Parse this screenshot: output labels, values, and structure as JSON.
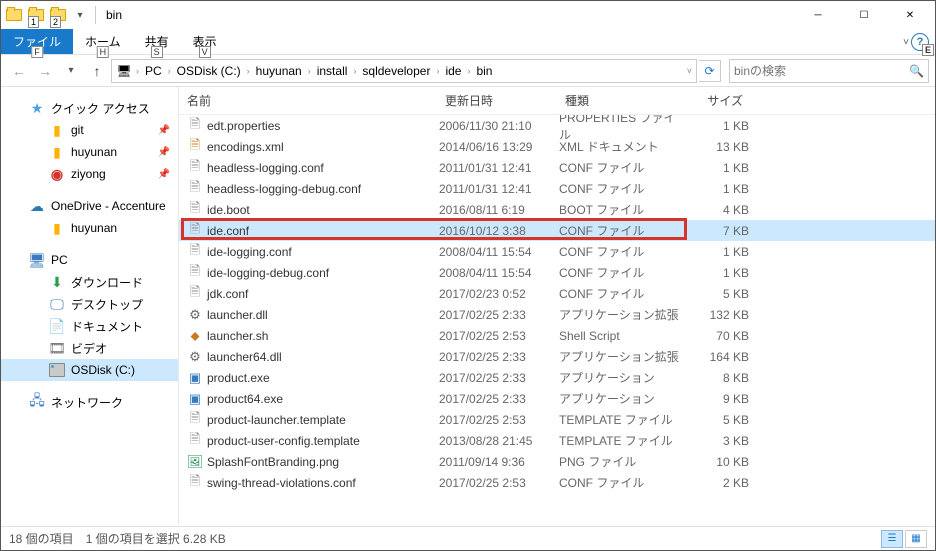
{
  "window": {
    "title": "bin"
  },
  "qat_badges": [
    "1",
    "2"
  ],
  "tabs": {
    "file": "ファイル",
    "file_kbd": "F",
    "home": "ホーム",
    "home_kbd": "H",
    "share": "共有",
    "share_kbd": "S",
    "view": "表示",
    "view_kbd": "V",
    "help_kbd": "E"
  },
  "breadcrumb": [
    "PC",
    "OSDisk (C:)",
    "huyunan",
    "install",
    "sqldeveloper",
    "ide",
    "bin"
  ],
  "search": {
    "placeholder": "binの検索"
  },
  "navpane": {
    "quick": "クイック アクセス",
    "items": [
      "git",
      "huyunan",
      "ziyong"
    ],
    "onedrive": "OneDrive - Accenture",
    "od_items": [
      "huyunan"
    ],
    "pc": "PC",
    "pc_items": [
      "ダウンロード",
      "デスクトップ",
      "ドキュメント",
      "ビデオ",
      "OSDisk (C:)"
    ],
    "network": "ネットワーク"
  },
  "columns": {
    "name": "名前",
    "date": "更新日時",
    "type": "種類",
    "size": "サイズ"
  },
  "files": [
    {
      "name": "edt.properties",
      "date": "2006/11/30 21:10",
      "type": "PROPERTIES ファイル",
      "size": "1 KB",
      "icon": "doc"
    },
    {
      "name": "encodings.xml",
      "date": "2014/06/16 13:29",
      "type": "XML ドキュメント",
      "size": "13 KB",
      "icon": "xml"
    },
    {
      "name": "headless-logging.conf",
      "date": "2011/01/31 12:41",
      "type": "CONF ファイル",
      "size": "1 KB",
      "icon": "doc"
    },
    {
      "name": "headless-logging-debug.conf",
      "date": "2011/01/31 12:41",
      "type": "CONF ファイル",
      "size": "1 KB",
      "icon": "doc"
    },
    {
      "name": "ide.boot",
      "date": "2016/08/11 6:19",
      "type": "BOOT ファイル",
      "size": "4 KB",
      "icon": "doc"
    },
    {
      "name": "ide.conf",
      "date": "2016/10/12 3:38",
      "type": "CONF ファイル",
      "size": "7 KB",
      "icon": "doc",
      "selected": true
    },
    {
      "name": "ide-logging.conf",
      "date": "2008/04/11 15:54",
      "type": "CONF ファイル",
      "size": "1 KB",
      "icon": "doc"
    },
    {
      "name": "ide-logging-debug.conf",
      "date": "2008/04/11 15:54",
      "type": "CONF ファイル",
      "size": "1 KB",
      "icon": "doc"
    },
    {
      "name": "jdk.conf",
      "date": "2017/02/23 0:52",
      "type": "CONF ファイル",
      "size": "5 KB",
      "icon": "doc"
    },
    {
      "name": "launcher.dll",
      "date": "2017/02/25 2:33",
      "type": "アプリケーション拡張",
      "size": "132 KB",
      "icon": "dll"
    },
    {
      "name": "launcher.sh",
      "date": "2017/02/25 2:53",
      "type": "Shell Script",
      "size": "70 KB",
      "icon": "shell"
    },
    {
      "name": "launcher64.dll",
      "date": "2017/02/25 2:33",
      "type": "アプリケーション拡張",
      "size": "164 KB",
      "icon": "dll"
    },
    {
      "name": "product.exe",
      "date": "2017/02/25 2:33",
      "type": "アプリケーション",
      "size": "8 KB",
      "icon": "exe"
    },
    {
      "name": "product64.exe",
      "date": "2017/02/25 2:33",
      "type": "アプリケーション",
      "size": "9 KB",
      "icon": "exe"
    },
    {
      "name": "product-launcher.template",
      "date": "2017/02/25 2:53",
      "type": "TEMPLATE ファイル",
      "size": "5 KB",
      "icon": "doc"
    },
    {
      "name": "product-user-config.template",
      "date": "2013/08/28 21:45",
      "type": "TEMPLATE ファイル",
      "size": "3 KB",
      "icon": "doc"
    },
    {
      "name": "SplashFontBranding.png",
      "date": "2011/09/14 9:36",
      "type": "PNG ファイル",
      "size": "10 KB",
      "icon": "png"
    },
    {
      "name": "swing-thread-violations.conf",
      "date": "2017/02/25 2:53",
      "type": "CONF ファイル",
      "size": "2 KB",
      "icon": "doc"
    }
  ],
  "status": {
    "items": "18 個の項目",
    "selected": "1 個の項目を選択   6.28 KB"
  }
}
